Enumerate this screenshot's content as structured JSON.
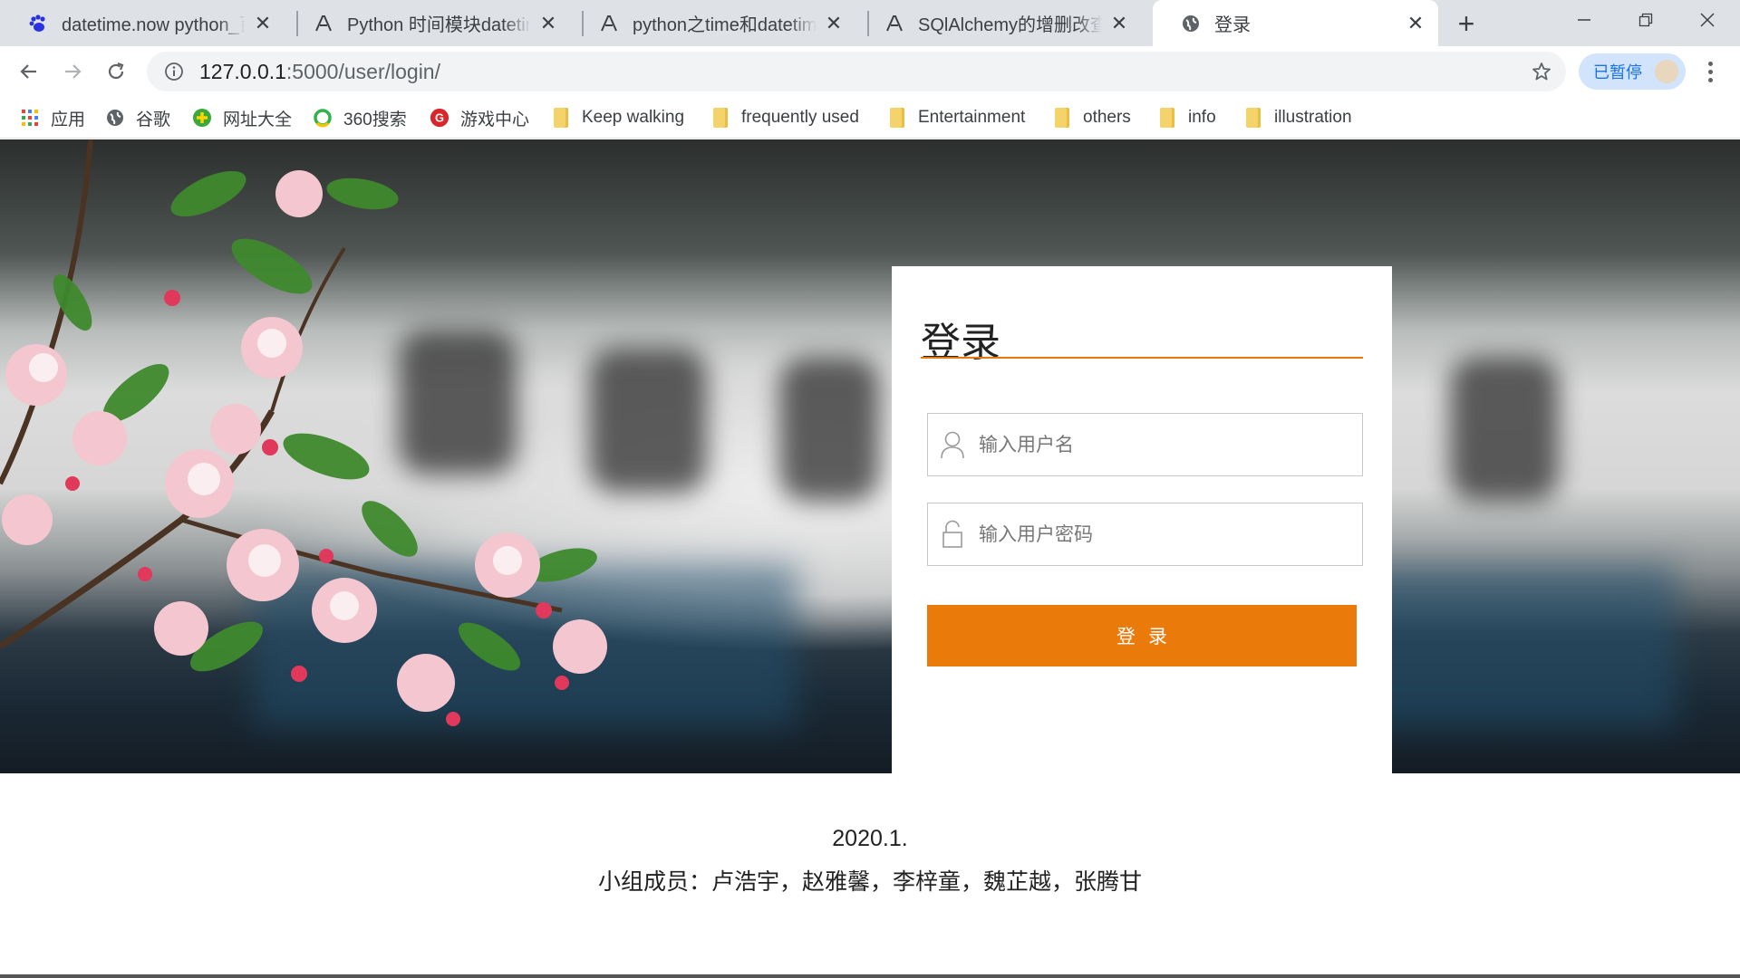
{
  "browser": {
    "tabs": [
      {
        "title": "datetime.now python_百度",
        "icon": "baidu-paw-icon",
        "active": false
      },
      {
        "title": "Python 时间模块datetime",
        "icon": "csdn-logo-icon",
        "active": false
      },
      {
        "title": "python之time和datetime",
        "icon": "csdn-logo-icon",
        "active": false
      },
      {
        "title": "SQlAlchemy的增删改查 - ",
        "icon": "csdn-logo-icon",
        "active": false
      },
      {
        "title": "登录",
        "icon": "globe-icon",
        "active": true
      }
    ],
    "url_host": "127.0.0.1",
    "url_rest": ":5000/user/login/",
    "profile_status": "已暂停"
  },
  "bookmarks": [
    {
      "label": "应用",
      "icon": "apps-grid-icon"
    },
    {
      "label": "谷歌",
      "icon": "globe-icon"
    },
    {
      "label": "网址大全",
      "icon": "hao-plus-icon"
    },
    {
      "label": "360搜索",
      "icon": "ring-search-icon"
    },
    {
      "label": "游戏中心",
      "icon": "game-logo-icon"
    },
    {
      "label": "Keep walking",
      "icon": "folder-icon"
    },
    {
      "label": "frequently used",
      "icon": "folder-icon"
    },
    {
      "label": "Entertainment",
      "icon": "folder-icon"
    },
    {
      "label": "others",
      "icon": "folder-icon"
    },
    {
      "label": "info",
      "icon": "folder-icon"
    },
    {
      "label": "illustration",
      "icon": "folder-icon"
    }
  ],
  "login": {
    "title": "登录",
    "username_placeholder": "输入用户名",
    "password_placeholder": "输入用户密码",
    "submit_label": "登录",
    "accent_color": "#ea7a0a"
  },
  "footer": {
    "date": "2020.1.",
    "members": "小组成员：卢浩宇，赵雅馨，李梓童，魏芷越，张腾甘"
  }
}
